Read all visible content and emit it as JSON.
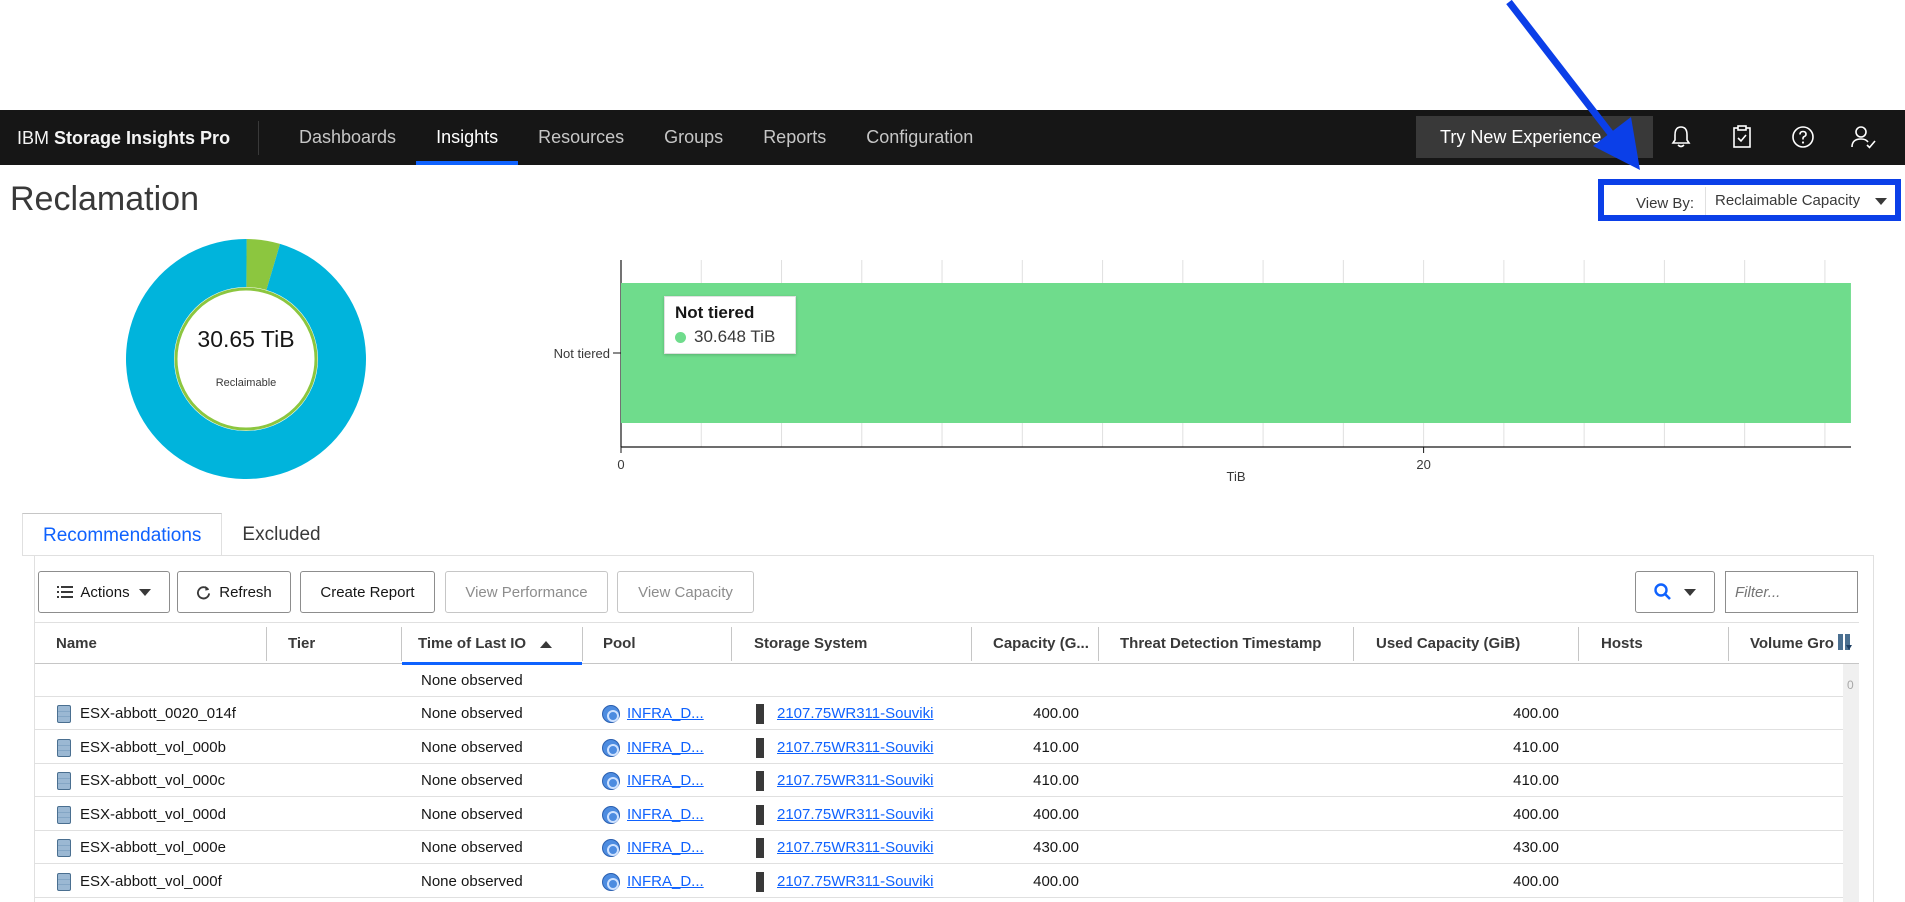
{
  "nav": {
    "brand_prefix": "IBM",
    "brand_name": "Storage Insights Pro",
    "items": [
      {
        "label": "Dashboards",
        "active": false
      },
      {
        "label": "Insights",
        "active": true
      },
      {
        "label": "Resources",
        "active": false
      },
      {
        "label": "Groups",
        "active": false
      },
      {
        "label": "Reports",
        "active": false
      },
      {
        "label": "Configuration",
        "active": false
      }
    ],
    "try_button": "Try New Experience",
    "icons": [
      "bell-icon",
      "clipboard-check-icon",
      "help-icon",
      "user-icon"
    ]
  },
  "page": {
    "title": "Reclamation",
    "view_by_label": "View By:",
    "view_by_value": "Reclaimable Capacity"
  },
  "donut": {
    "value": "30.65 TiB",
    "sub": "Reclaimable"
  },
  "chart_data": [
    {
      "type": "pie",
      "title": "",
      "center_text": "30.65 TiB",
      "center_subtext": "Reclaimable",
      "slices": [
        {
          "label": "",
          "value": 0.955,
          "color": "#00b4dc"
        },
        {
          "label": "",
          "value": 0.045,
          "color": "#8cc63f"
        }
      ]
    },
    {
      "type": "bar",
      "orientation": "horizontal",
      "categories": [
        "Not tiered"
      ],
      "values": [
        30.648
      ],
      "xlabel": "TiB",
      "ylabel": "",
      "xlim": [
        0,
        30.65
      ],
      "xticks": [
        0,
        20
      ],
      "grid": true,
      "color": "#6fdc8c",
      "tooltip": {
        "title": "Not tiered",
        "value": "30.648 TiB"
      }
    }
  ],
  "tabs": [
    {
      "label": "Recommendations",
      "active": true
    },
    {
      "label": "Excluded",
      "active": false
    }
  ],
  "toolbar": {
    "actions": "Actions",
    "refresh": "Refresh",
    "create_report": "Create Report",
    "view_performance": "View Performance",
    "view_capacity": "View Capacity",
    "filter_placeholder": "Filter..."
  },
  "table": {
    "columns": [
      "Name",
      "Tier",
      "Time of Last IO",
      "Pool",
      "Storage System",
      "Capacity (G...",
      "Threat Detection Timestamp",
      "Used Capacity (GiB)",
      "Hosts",
      "Volume Gro"
    ],
    "summary_row": {
      "time_of_last_io": "None observed"
    },
    "rows": [
      {
        "name": "ESX-abbott_0020_014f",
        "tier": "",
        "last_io": "None observed",
        "pool": "INFRA_D...",
        "system": "2107.75WR311-Souviki",
        "capacity": "400.00",
        "threat": "",
        "used": "400.00",
        "hosts": ""
      },
      {
        "name": "ESX-abbott_vol_000b",
        "tier": "",
        "last_io": "None observed",
        "pool": "INFRA_D...",
        "system": "2107.75WR311-Souviki",
        "capacity": "410.00",
        "threat": "",
        "used": "410.00",
        "hosts": ""
      },
      {
        "name": "ESX-abbott_vol_000c",
        "tier": "",
        "last_io": "None observed",
        "pool": "INFRA_D...",
        "system": "2107.75WR311-Souviki",
        "capacity": "410.00",
        "threat": "",
        "used": "410.00",
        "hosts": ""
      },
      {
        "name": "ESX-abbott_vol_000d",
        "tier": "",
        "last_io": "None observed",
        "pool": "INFRA_D...",
        "system": "2107.75WR311-Souviki",
        "capacity": "400.00",
        "threat": "",
        "used": "400.00",
        "hosts": ""
      },
      {
        "name": "ESX-abbott_vol_000e",
        "tier": "",
        "last_io": "None observed",
        "pool": "INFRA_D...",
        "system": "2107.75WR311-Souviki",
        "capacity": "430.00",
        "threat": "",
        "used": "430.00",
        "hosts": ""
      },
      {
        "name": "ESX-abbott_vol_000f",
        "tier": "",
        "last_io": "None observed",
        "pool": "INFRA_D...",
        "system": "2107.75WR311-Souviki",
        "capacity": "400.00",
        "threat": "",
        "used": "400.00",
        "hosts": ""
      }
    ],
    "scroll_indicator": "0"
  },
  "colors": {
    "nav_bg": "#161616",
    "accent": "#0f62fe",
    "annotation": "#0b3fe8",
    "donut_main": "#00b4dc",
    "donut_minor": "#8cc63f",
    "bar": "#6fdc8c"
  }
}
